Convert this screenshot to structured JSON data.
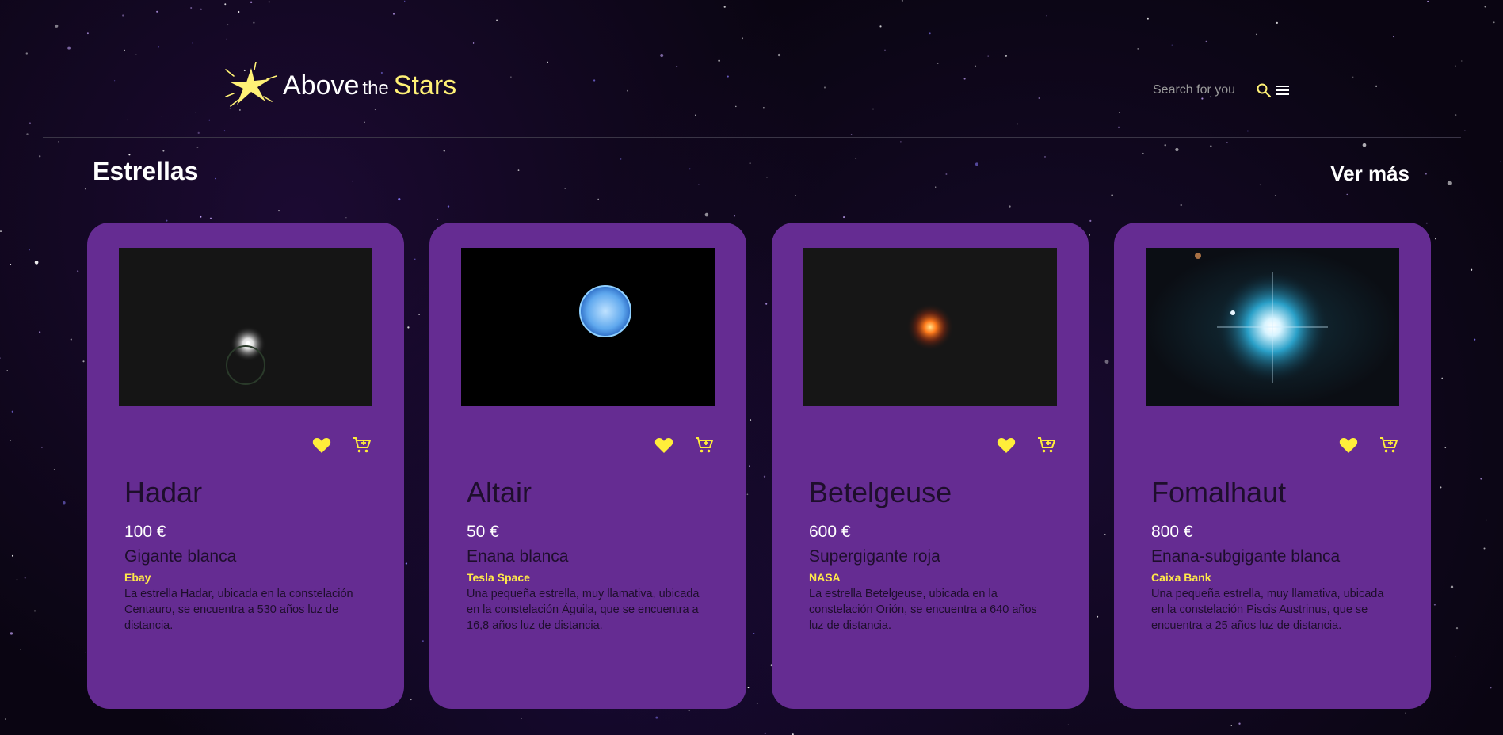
{
  "header": {
    "logo": {
      "word1": "Above",
      "word2": "the",
      "word3": "Stars"
    },
    "search_placeholder": "Search for you"
  },
  "section": {
    "title": "Estrellas",
    "more_link": "Ver más"
  },
  "colors": {
    "card": "#652c92",
    "accent": "#fff176",
    "background": "#0a0512"
  },
  "cards": [
    {
      "name": "Hadar",
      "price": "100 €",
      "type": "Gigante blanca",
      "seller": "Ebay",
      "description": "La estrella Hadar, ubicada en la constelación Centauro, se encuentra a 530 años luz de distancia."
    },
    {
      "name": "Altair",
      "price": "50 €",
      "type": "Enana blanca",
      "seller": "Tesla Space",
      "description": "Una pequeña estrella, muy llamativa, ubicada en la constelación Águila, que se encuentra a 16,8 años luz de distancia."
    },
    {
      "name": "Betelgeuse",
      "price": "600 €",
      "type": "Supergigante roja",
      "seller": "NASA",
      "description": "La estrella Betelgeuse, ubicada en la constelación Orión, se encuentra a 640 años luz de distancia."
    },
    {
      "name": "Fomalhaut",
      "price": "800 €",
      "type": "Enana-subgigante blanca",
      "seller": "Caixa Bank",
      "description": "Una pequeña estrella, muy llamativa, ubicada en la constelación Piscis Austrinus, que se encuentra a 25 años luz de distancia."
    }
  ],
  "icons": {
    "logo": "star-logo-icon",
    "search": "search-icon",
    "menu": "menu-icon",
    "favorite": "heart-icon",
    "cart": "add-to-cart-icon"
  }
}
